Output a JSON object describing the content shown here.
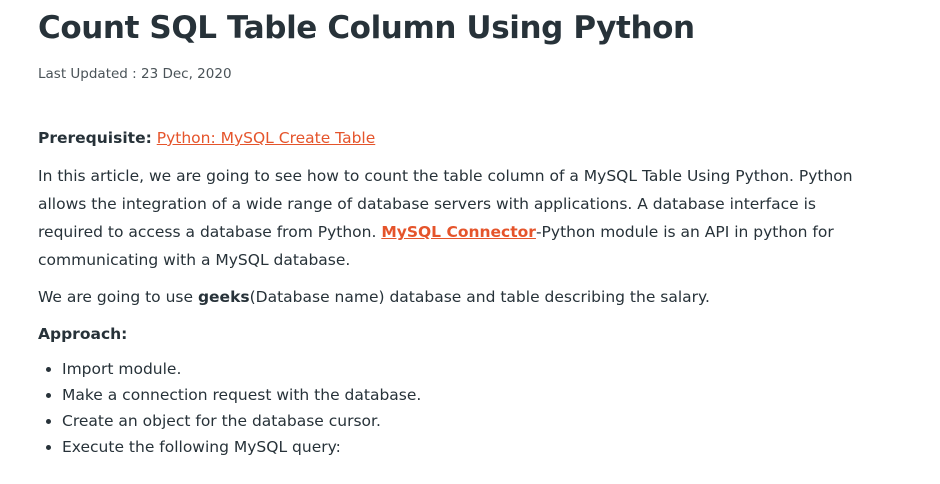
{
  "article": {
    "title": "Count SQL Table Column Using Python",
    "last_updated": "Last Updated : 23 Dec, 2020",
    "prerequisite_label": "Prerequisite:",
    "prerequisite_link": "Python: MySQL Create Table",
    "intro_part1": "In this article, we are going to see how to count the table column of a MySQL Table Using Python. Python allows the integration of a wide range of database servers with applications. A database interface is required to access a database from Python. ",
    "intro_link": "MySQL Connector",
    "intro_part2": "-Python module is an API in python for communicating with a MySQL database.",
    "db_part1": "We are going to use ",
    "db_bold": "geeks",
    "db_part2": "(Database name) database and table describing the salary.",
    "approach_label": "Approach:",
    "steps": [
      "Import module.",
      "Make a connection request with the database.",
      "Create an object for the database cursor.",
      "Execute the following MySQL query:"
    ]
  },
  "colors": {
    "text": "#273239",
    "link": "#e5542b"
  }
}
